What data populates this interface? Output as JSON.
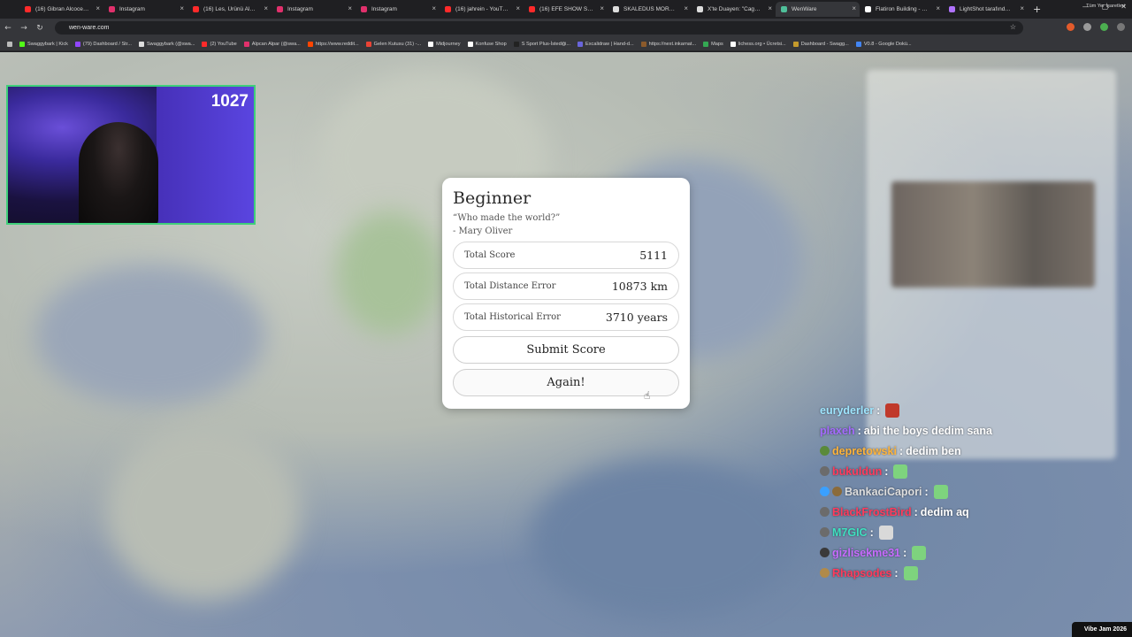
{
  "tabs": [
    {
      "title": "(16) Gibran Alcocer - I",
      "color": "#ff2a2a"
    },
    {
      "title": "Instagram",
      "color": "#e1306c"
    },
    {
      "title": "(16) Les, Ürünü Almak",
      "color": "#ff2a2a"
    },
    {
      "title": "Instagram",
      "color": "#e1306c"
    },
    {
      "title": "Instagram",
      "color": "#e1306c"
    },
    {
      "title": "(16) jahrein - YouTube",
      "color": "#ff2a2a"
    },
    {
      "title": "(16) EFE SHOW S3B2",
      "color": "#ff2a2a"
    },
    {
      "title": "SKALEDUS MORTIMA",
      "color": "#dddddd"
    },
    {
      "title": "X'te Duayen: \"Cago w",
      "color": "#dddddd"
    },
    {
      "title": "WenWare",
      "color": "#4fbf9a"
    },
    {
      "title": "Flatiron Building - Wik",
      "color": "#ffffff"
    },
    {
      "title": "LightShot tarafından I",
      "color": "#b072ff"
    }
  ],
  "address": "wen-ware.com",
  "bookmarks": [
    {
      "label": "Swaggybark | Kick",
      "color": "#53fc18"
    },
    {
      "label": "(79) Dashboard / Str...",
      "color": "#9146ff"
    },
    {
      "label": "Swaggybark (@swa...",
      "color": "#dddddd"
    },
    {
      "label": "(2) YouTube",
      "color": "#ff2a2a"
    },
    {
      "label": "Alpcan Alpar (@swa...",
      "color": "#e1306c"
    },
    {
      "label": "https://www.reddit...",
      "color": "#ff4500"
    },
    {
      "label": "Gelen Kutusu (31) -...",
      "color": "#ea4335"
    },
    {
      "label": "Midjourney",
      "color": "#ffffff"
    },
    {
      "label": "Konfuse Shop",
      "color": "#ffffff"
    },
    {
      "label": "S Sport Plus-İstediği...",
      "color": "#222222"
    },
    {
      "label": "Excalidraw | Hand-d...",
      "color": "#6965db"
    },
    {
      "label": "https://next.inkarnat...",
      "color": "#8b5a2b"
    },
    {
      "label": "Maps",
      "color": "#34a853"
    },
    {
      "label": "lichess.org • Ücretsi...",
      "color": "#ffffff"
    },
    {
      "label": "Dashboard - Swagg...",
      "color": "#c49a2c"
    },
    {
      "label": "V0.8 - Google Dokü...",
      "color": "#4285f4"
    }
  ],
  "all_bookmarks": "Tüm Yer İşaretleri",
  "webcam": {
    "count": "1027"
  },
  "modal": {
    "title": "Beginner",
    "quote": "“Who made the world?”",
    "author": "- Mary Oliver",
    "stats": [
      {
        "label": "Total Score",
        "value": "5111"
      },
      {
        "label": "Total Distance Error",
        "value": "10873 km"
      },
      {
        "label": "Total Historical Error",
        "value": "3710 years"
      }
    ],
    "submit_label": "Submit Score",
    "again_label": "Again!"
  },
  "chat": [
    {
      "user": "euryderler",
      "color": "#9fe6ff",
      "sep": " :",
      "text": "",
      "badges": [],
      "emote": "#c0392b"
    },
    {
      "user": "plaxeh",
      "color": "#a56bff",
      "sep": " :",
      "text": " abi the boys dedim sana",
      "badges": [],
      "emote": ""
    },
    {
      "user": "depretowski",
      "color": "#ffb43a",
      "sep": " :",
      "text": " dedim ben",
      "badges": [
        "#5a8a3a"
      ],
      "emote": ""
    },
    {
      "user": "bukuldun",
      "color": "#ff3b5c",
      "sep": " :",
      "text": "",
      "badges": [
        "#6b6b6b"
      ],
      "emote": "#7ed37e"
    },
    {
      "user": "BankaciCapori",
      "color": "#dedede",
      "sep": " :",
      "text": "",
      "badges": [
        "#3aa0ff",
        "#8b6b3a"
      ],
      "emote": "#7ed37e"
    },
    {
      "user": "BlackFrostBird",
      "color": "#ff3b5c",
      "sep": " :",
      "text": " dedim aq",
      "badges": [
        "#6b6b6b"
      ],
      "emote": ""
    },
    {
      "user": "M7GIC",
      "color": "#3fe0c0",
      "sep": " :",
      "text": "",
      "badges": [
        "#6b6b6b"
      ],
      "emote": "#d9d9d9"
    },
    {
      "user": "gizlisekme31",
      "color": "#c86bff",
      "sep": " :",
      "text": "",
      "badges": [
        "#3a3a3a"
      ],
      "emote": "#7ed37e"
    },
    {
      "user": "Rhapsodes",
      "color": "#ff3b5c",
      "sep": " :",
      "text": "",
      "badges": [
        "#b08a4a"
      ],
      "emote": "#7ed37e"
    }
  ],
  "vibejam": "Vibe Jam 2026"
}
